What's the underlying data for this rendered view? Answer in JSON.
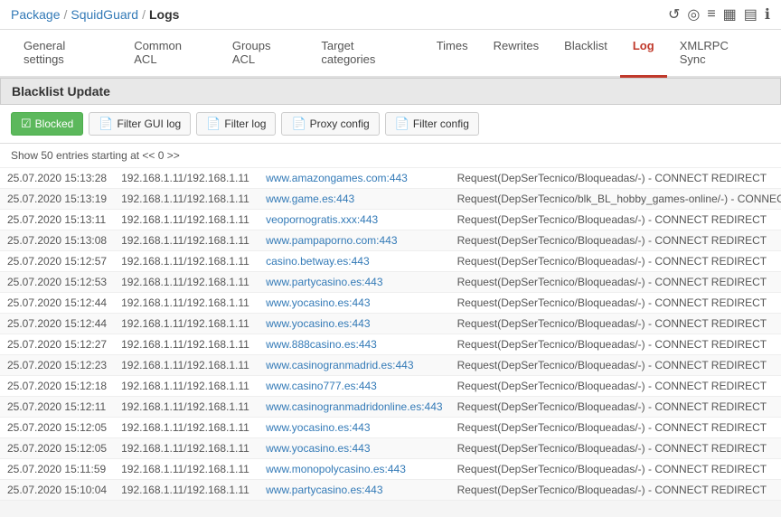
{
  "breadcrumb": {
    "package": "Package",
    "squidguard": "SquidGuard",
    "logs": "Logs"
  },
  "top_icons": [
    {
      "name": "refresh-icon",
      "symbol": "↺"
    },
    {
      "name": "target-icon",
      "symbol": "◎"
    },
    {
      "name": "list-icon",
      "symbol": "≡"
    },
    {
      "name": "chart-icon",
      "symbol": "▦"
    },
    {
      "name": "table-icon",
      "symbol": "▤"
    },
    {
      "name": "info-icon",
      "symbol": "ℹ"
    }
  ],
  "tabs": [
    {
      "label": "General settings",
      "active": false
    },
    {
      "label": "Common ACL",
      "active": false
    },
    {
      "label": "Groups ACL",
      "active": false
    },
    {
      "label": "Target categories",
      "active": false
    },
    {
      "label": "Times",
      "active": false
    },
    {
      "label": "Rewrites",
      "active": false
    },
    {
      "label": "Blacklist",
      "active": false
    },
    {
      "label": "Log",
      "active": true
    },
    {
      "label": "XMLRPC Sync",
      "active": false
    }
  ],
  "section_title": "Blacklist Update",
  "toolbar": {
    "blocked_label": "Blocked",
    "filter_gui_label": "Filter GUI log",
    "filter_log_label": "Filter log",
    "proxy_config_label": "Proxy config",
    "filter_config_label": "Filter config"
  },
  "info_row": "Show 50 entries starting at << 0 >>",
  "table": {
    "rows": [
      {
        "date": "25.07.2020 15:13:28",
        "ip": "192.168.1.11/192.168.1.11",
        "domain": "www.amazongames.com:443",
        "request": "Request(DepSerTecnico/Bloqueadas/-) - CONNECT REDIRECT"
      },
      {
        "date": "25.07.2020 15:13:19",
        "ip": "192.168.1.11/192.168.1.11",
        "domain": "www.game.es:443",
        "request": "Request(DepSerTecnico/blk_BL_hobby_games-online/-) - CONNECT REDIRECT"
      },
      {
        "date": "25.07.2020 15:13:11",
        "ip": "192.168.1.11/192.168.1.11",
        "domain": "veopornogratis.xxx:443",
        "request": "Request(DepSerTecnico/Bloqueadas/-) - CONNECT REDIRECT"
      },
      {
        "date": "25.07.2020 15:13:08",
        "ip": "192.168.1.11/192.168.1.11",
        "domain": "www.pampaporno.com:443",
        "request": "Request(DepSerTecnico/Bloqueadas/-) - CONNECT REDIRECT"
      },
      {
        "date": "25.07.2020 15:12:57",
        "ip": "192.168.1.11/192.168.1.11",
        "domain": "casino.betway.es:443",
        "request": "Request(DepSerTecnico/Bloqueadas/-) - CONNECT REDIRECT"
      },
      {
        "date": "25.07.2020 15:12:53",
        "ip": "192.168.1.11/192.168.1.11",
        "domain": "www.partycasino.es:443",
        "request": "Request(DepSerTecnico/Bloqueadas/-) - CONNECT REDIRECT"
      },
      {
        "date": "25.07.2020 15:12:44",
        "ip": "192.168.1.11/192.168.1.11",
        "domain": "www.yocasino.es:443",
        "request": "Request(DepSerTecnico/Bloqueadas/-) - CONNECT REDIRECT"
      },
      {
        "date": "25.07.2020 15:12:44",
        "ip": "192.168.1.11/192.168.1.11",
        "domain": "www.yocasino.es:443",
        "request": "Request(DepSerTecnico/Bloqueadas/-) - CONNECT REDIRECT"
      },
      {
        "date": "25.07.2020 15:12:27",
        "ip": "192.168.1.11/192.168.1.11",
        "domain": "www.888casino.es:443",
        "request": "Request(DepSerTecnico/Bloqueadas/-) - CONNECT REDIRECT"
      },
      {
        "date": "25.07.2020 15:12:23",
        "ip": "192.168.1.11/192.168.1.11",
        "domain": "www.casinogranmadrid.es:443",
        "request": "Request(DepSerTecnico/Bloqueadas/-) - CONNECT REDIRECT"
      },
      {
        "date": "25.07.2020 15:12:18",
        "ip": "192.168.1.11/192.168.1.11",
        "domain": "www.casino777.es:443",
        "request": "Request(DepSerTecnico/Bloqueadas/-) - CONNECT REDIRECT"
      },
      {
        "date": "25.07.2020 15:12:11",
        "ip": "192.168.1.11/192.168.1.11",
        "domain": "www.casinogranmadridonline.es:443",
        "request": "Request(DepSerTecnico/Bloqueadas/-) - CONNECT REDIRECT"
      },
      {
        "date": "25.07.2020 15:12:05",
        "ip": "192.168.1.11/192.168.1.11",
        "domain": "www.yocasino.es:443",
        "request": "Request(DepSerTecnico/Bloqueadas/-) - CONNECT REDIRECT"
      },
      {
        "date": "25.07.2020 15:12:05",
        "ip": "192.168.1.11/192.168.1.11",
        "domain": "www.yocasino.es:443",
        "request": "Request(DepSerTecnico/Bloqueadas/-) - CONNECT REDIRECT"
      },
      {
        "date": "25.07.2020 15:11:59",
        "ip": "192.168.1.11/192.168.1.11",
        "domain": "www.monopolycasino.es:443",
        "request": "Request(DepSerTecnico/Bloqueadas/-) - CONNECT REDIRECT"
      },
      {
        "date": "25.07.2020 15:10:04",
        "ip": "192.168.1.11/192.168.1.11",
        "domain": "www.partycasino.es:443",
        "request": "Request(DepSerTecnico/Bloqueadas/-) - CONNECT REDIRECT"
      }
    ]
  }
}
